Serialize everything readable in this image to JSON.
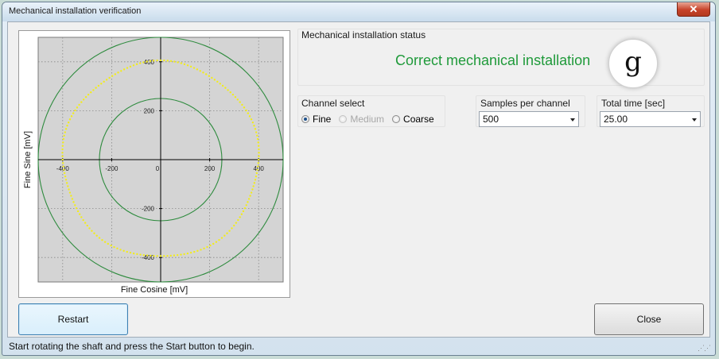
{
  "window": {
    "title": "Mechanical installation verification",
    "close_glyph": "✕"
  },
  "status_group": {
    "caption": "Mechanical installation status",
    "message": "Correct mechanical installation",
    "badge_letter": "g",
    "message_color": "#1f9a3a"
  },
  "channel_select": {
    "caption": "Channel select",
    "options": [
      {
        "label": "Fine",
        "selected": true,
        "enabled": true
      },
      {
        "label": "Medium",
        "selected": false,
        "enabled": false
      },
      {
        "label": "Coarse",
        "selected": false,
        "enabled": true
      }
    ]
  },
  "samples": {
    "caption": "Samples per channel",
    "value": "500"
  },
  "total_time": {
    "caption": "Total time [sec]",
    "value": "25.00"
  },
  "buttons": {
    "restart": "Restart",
    "close": "Close"
  },
  "statusbar": {
    "text": "Start rotating the shaft and press the Start button to begin."
  },
  "chart_data": {
    "type": "scatter",
    "xlabel": "Fine Cosine [mV]",
    "ylabel": "Fine Sine [mV]",
    "xlim": [
      -500,
      500
    ],
    "ylim": [
      -500,
      500
    ],
    "x_ticks": [
      -400,
      -200,
      0,
      200,
      400
    ],
    "y_ticks": [
      -400,
      -200,
      0,
      200,
      400
    ],
    "x_tick_labels": [
      "-400",
      "-200",
      "0",
      "200",
      "400"
    ],
    "y_tick_labels": [
      "-400",
      "-200",
      "0",
      "200",
      "400"
    ],
    "grid": true,
    "reference_circles": [
      {
        "radius": 250,
        "color": "#2e8b3e"
      },
      {
        "radius": 500,
        "color": "#2e8b3e"
      }
    ],
    "series": [
      {
        "radius": 400,
        "color": "#f2ec1c",
        "points": 180
      }
    ],
    "background": "#d4d4d4"
  }
}
